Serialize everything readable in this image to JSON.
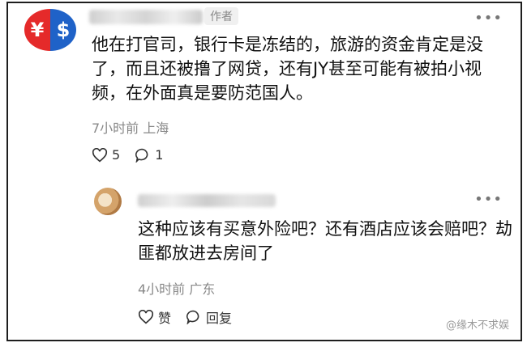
{
  "comment": {
    "author_badge": "作者",
    "text": "他在打官司，银行卡是冻结的，旅游的资金肯定是没了，而且还被撸了网贷，还有JY甚至可能有被拍小视频，在外面真是要防范国人。",
    "time_location": "7小时前 上海",
    "likes": "5",
    "replies": "1"
  },
  "reply": {
    "text": "这种应该有买意外险吧？还有酒店应该会赔吧？劫匪都放进去房间了",
    "time_location": "4小时前 广东",
    "like_label": "赞",
    "reply_label": "回复"
  },
  "watermark": "@缘木不求娱",
  "icons": {
    "more": "more-dots-icon",
    "like": "heart-icon",
    "comment": "chat-bubble-icon"
  },
  "colors": {
    "avatar_red": "#e52a2a",
    "avatar_blue": "#1f62c8",
    "meta_gray": "#888888"
  }
}
